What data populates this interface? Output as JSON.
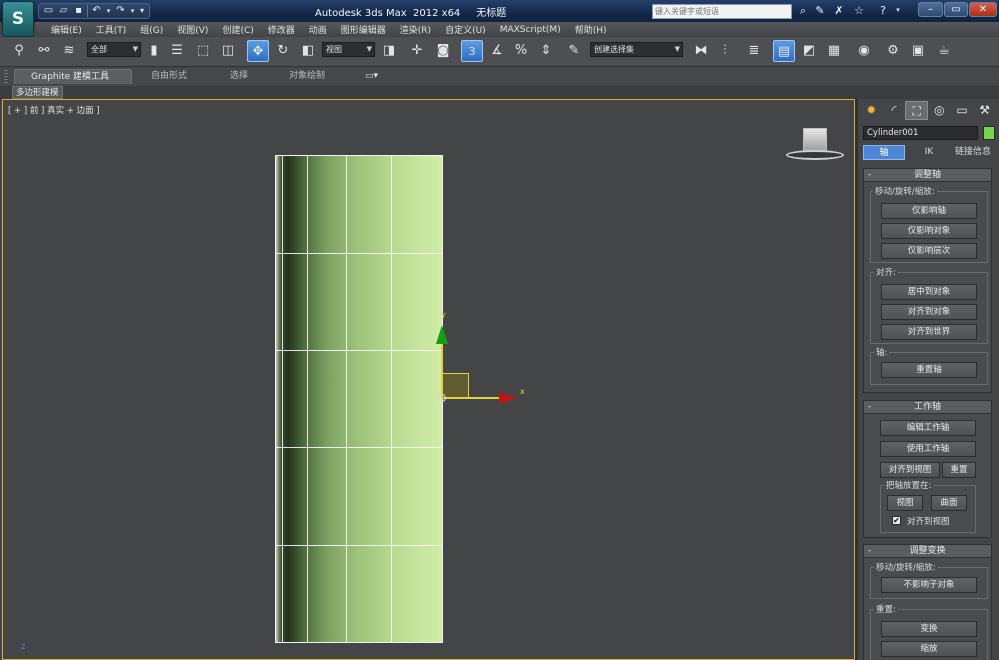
{
  "titlebar": {
    "logo": "S",
    "title": "Autodesk 3ds Max  2012 x64     无标题",
    "search_placeholder": "键入关键字或短语",
    "qat_icons": [
      "new-file-icon",
      "open-file-icon",
      "save-icon",
      "undo-icon",
      "redo-icon",
      "customize-icon"
    ]
  },
  "menu": {
    "items": [
      "编辑(E)",
      "工具(T)",
      "组(G)",
      "视图(V)",
      "创建(C)",
      "修改器",
      "动画",
      "图形编辑器",
      "渲染(R)",
      "自定义(U)",
      "MAXScript(M)",
      "帮助(H)"
    ]
  },
  "toolbar": {
    "selection_filter": "全部",
    "reference_coord": "视图",
    "snap_value": "3",
    "named_selection": "创建选择集"
  },
  "ribbon": {
    "tabs": [
      "Graphite 建模工具",
      "自由形式",
      "选择",
      "对象绘制"
    ],
    "sub_label": "多边形建模"
  },
  "viewport": {
    "label": "[ + ] 前 ] 真实 + 边面 ]",
    "x_axis": "x",
    "y_axis": "y",
    "tripod_label": "z"
  },
  "cmdpanel": {
    "object_name": "Cylinder001",
    "object_color": "#76d64f",
    "hier_tabs": [
      "轴",
      "IK",
      "链接信息"
    ],
    "adjust_pivot": {
      "title": "调整轴",
      "group_move": "移动/旋转/缩放:",
      "btn_pivot_only": "仅影响轴",
      "btn_object_only": "仅影响对象",
      "btn_hierarchy_only": "仅影响层次",
      "group_align": "对齐:",
      "btn_center": "居中到对象",
      "btn_align_object": "对齐到对象",
      "btn_align_world": "对齐到世界",
      "group_pivot": "轴:",
      "btn_reset_pivot": "重置轴"
    },
    "working_pivot": {
      "title": "工作轴",
      "btn_edit": "编辑工作轴",
      "btn_use": "使用工作轴",
      "btn_align_view": "对齐到视图",
      "btn_reset": "重置",
      "group_place": "把轴放置在:",
      "btn_view": "视图",
      "btn_surface": "曲面",
      "check_align_view": "对齐到视图",
      "check_align_view_checked": true
    },
    "adjust_transform": {
      "title": "调整变换",
      "group_move": "移动/旋转/缩放:",
      "btn_dont_affect": "不影响子对象",
      "group_reset": "重置:",
      "btn_transform": "变换",
      "btn_scale": "缩放"
    }
  }
}
